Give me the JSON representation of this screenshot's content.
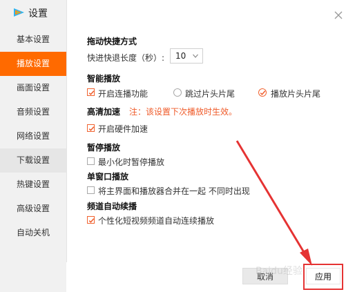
{
  "window": {
    "title": "设置"
  },
  "sidebar": {
    "items": [
      {
        "label": "基本设置",
        "state": "normal"
      },
      {
        "label": "播放设置",
        "state": "active"
      },
      {
        "label": "画面设置",
        "state": "normal"
      },
      {
        "label": "音频设置",
        "state": "normal"
      },
      {
        "label": "网络设置",
        "state": "normal"
      },
      {
        "label": "下载设置",
        "state": "hover"
      },
      {
        "label": "热键设置",
        "state": "normal"
      },
      {
        "label": "高级设置",
        "state": "normal"
      },
      {
        "label": "自动关机",
        "state": "normal"
      }
    ]
  },
  "sections": {
    "seek": {
      "title": "拖动快捷方式",
      "label": "快进快退长度（秒）:",
      "value": "10"
    },
    "smart": {
      "title": "智能播放",
      "options": [
        {
          "label": "开启连播功能",
          "checked": true
        },
        {
          "label": "跳过片头片尾",
          "checked": false
        },
        {
          "label": "播放片头片尾",
          "checked": true
        }
      ]
    },
    "hd": {
      "title": "高清加速",
      "note": "注：该设置下次播放时生效。",
      "option": {
        "label": "开启硬件加速",
        "checked": true
      }
    },
    "pause": {
      "title": "暂停播放",
      "option": {
        "label": "最小化时暂停播放",
        "checked": false
      }
    },
    "single": {
      "title": "单窗口播放",
      "option": {
        "label": "将主界面和播放器合并在一起 不同时出现",
        "checked": false
      }
    },
    "channel": {
      "title": "频道自动续播",
      "option": {
        "label": "个性化短视频频道自动连续播放",
        "checked": true
      }
    }
  },
  "footer": {
    "cancel_label": "取消",
    "apply_label": "应用"
  },
  "icons": {
    "logo": "tencent-video-logo-icon",
    "close": "close-icon",
    "check": "checkmark-icon",
    "dropdown": "chevron-down-icon"
  },
  "colors": {
    "accent": "#ff6a00",
    "note": "#ef5b2a",
    "annotation": "#e53333"
  },
  "watermark": "Baidu经验"
}
